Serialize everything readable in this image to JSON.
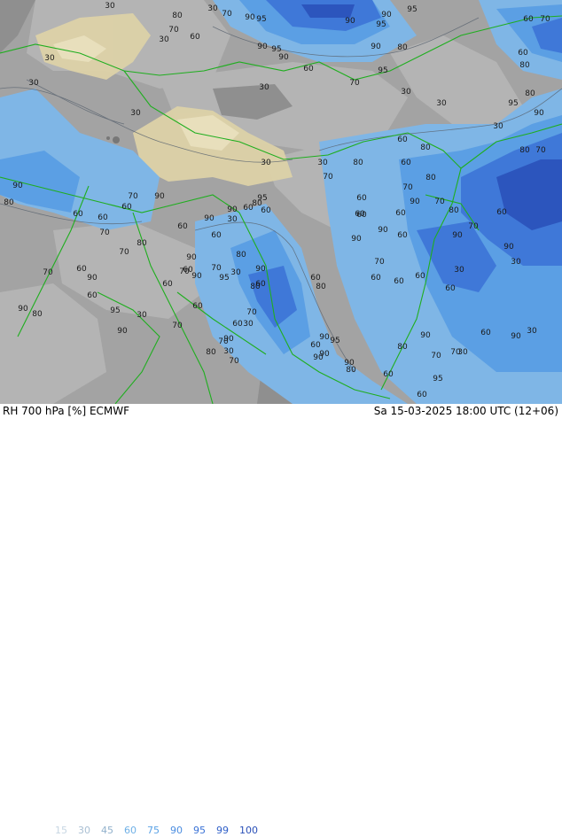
{
  "footer": {
    "title": "RH 700 hPa [%] ECMWF",
    "datetime": "Sa 15-03-2025 18:00 UTC (12+06)"
  },
  "legend": [
    {
      "label": "15",
      "color": "#c7d6e3"
    },
    {
      "label": "30",
      "color": "#a9bfd3"
    },
    {
      "label": "45",
      "color": "#91b1cc"
    },
    {
      "label": "60",
      "color": "#6fb0e6"
    },
    {
      "label": "75",
      "color": "#5aa2e6"
    },
    {
      "label": "90",
      "color": "#4b8de0"
    },
    {
      "label": "95",
      "color": "#3a72d6"
    },
    {
      "label": "99",
      "color": "#2f5fc8"
    },
    {
      "label": "100",
      "color": "#2a50b8"
    }
  ],
  "contour_labels": [
    "30",
    "30",
    "70",
    "90",
    "95",
    "95",
    "60",
    "70",
    "80",
    "70",
    "30",
    "60",
    "90",
    "95",
    "90",
    "90",
    "90",
    "95",
    "90",
    "80",
    "60",
    "95",
    "60",
    "80",
    "80",
    "70",
    "90",
    "95",
    "30",
    "30",
    "30",
    "30",
    "30",
    "30",
    "30",
    "60",
    "80",
    "80",
    "30",
    "70",
    "30",
    "70",
    "60",
    "60",
    "60",
    "80",
    "60",
    "90",
    "70",
    "60",
    "80",
    "60",
    "90",
    "70",
    "90",
    "30",
    "30",
    "60",
    "60",
    "70",
    "90",
    "90",
    "60",
    "60",
    "60",
    "80",
    "70",
    "60",
    "30",
    "80",
    "70",
    "90",
    "30",
    "70",
    "80",
    "60",
    "60",
    "90",
    "70",
    "95",
    "90",
    "80",
    "90",
    "30",
    "95",
    "90",
    "60",
    "80",
    "70",
    "60",
    "90",
    "30",
    "70",
    "60",
    "60",
    "90",
    "70",
    "95",
    "60",
    "90",
    "60",
    "90",
    "60",
    "80",
    "90",
    "70",
    "80",
    "90",
    "60",
    "95",
    "90",
    "30",
    "70",
    "60",
    "80",
    "60",
    "90",
    "60",
    "95",
    "80",
    "90",
    "70",
    "60",
    "60",
    "70",
    "80",
    "70",
    "60",
    "80",
    "30",
    "90",
    "60",
    "90",
    "30",
    "90",
    "70",
    "60"
  ],
  "colors": {
    "land_dry": "#9b9b9b",
    "land_gray": "#a7a7a7",
    "desert": "#ddd2a8",
    "border": "#1fae1f"
  }
}
